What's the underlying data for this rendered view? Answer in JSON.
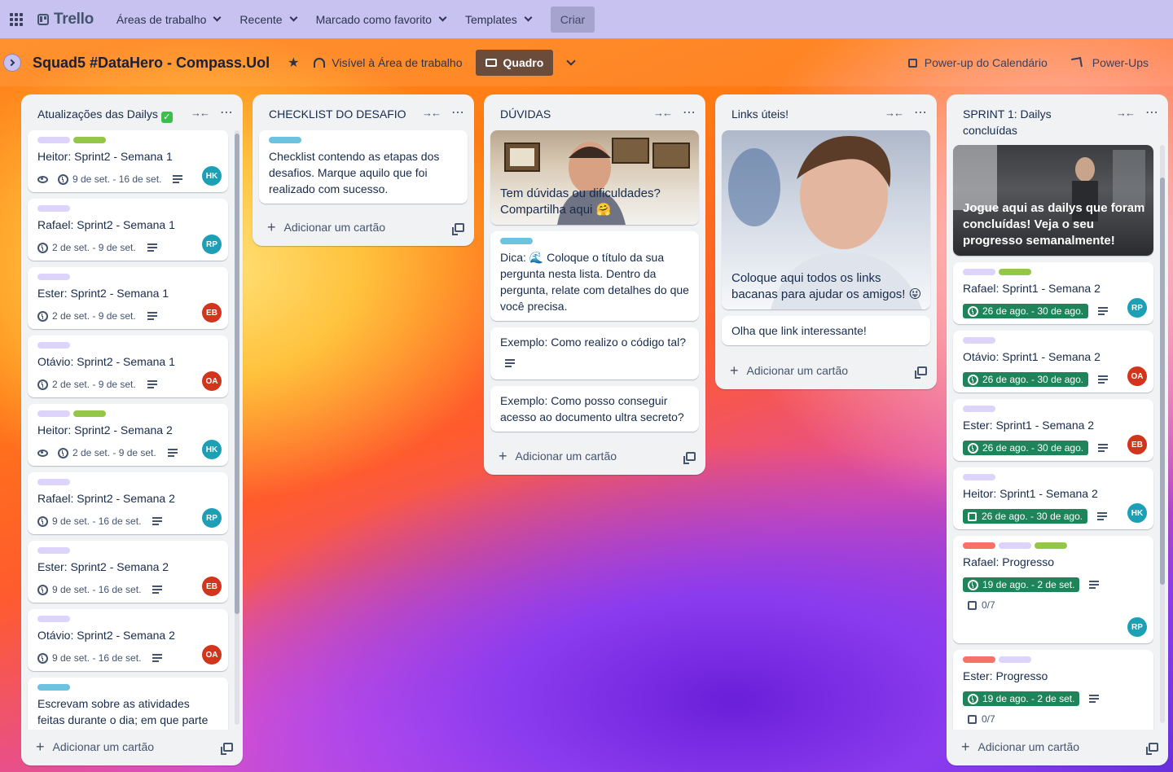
{
  "nav": {
    "logo": "Trello",
    "workspaces": "Áreas de trabalho",
    "recent": "Recente",
    "starred": "Marcado como favorito",
    "templates": "Templates",
    "create": "Criar"
  },
  "board": {
    "title": "Squad5 #DataHero - Compass.Uol",
    "visibility": "Visível à Área de trabalho",
    "view": "Quadro",
    "calendar": "Power-up do Calendário",
    "powerups": "Power-Ups"
  },
  "add_card": "Adicionar um cartão",
  "lists": [
    {
      "title": "Atualizações das Dailys",
      "cards": [
        {
          "title": "Heitor: Sprint2 - Semana 1",
          "date": "9 de set. - 16 de set.",
          "avatar": "HK"
        },
        {
          "title": "Rafael: Sprint2 - Semana 1",
          "date": "2 de set. - 9 de set.",
          "avatar": "RP"
        },
        {
          "title": "Ester: Sprint2 - Semana 1",
          "date": "2 de set. - 9 de set.",
          "avatar": "EB"
        },
        {
          "title": "Otávio: Sprint2 - Semana 1",
          "date": "2 de set. - 9 de set.",
          "avatar": "OA"
        },
        {
          "title": "Heitor: Sprint2 - Semana 2",
          "date": "2 de set. - 9 de set.",
          "avatar": "HK"
        },
        {
          "title": "Rafael: Sprint2 - Semana 2",
          "date": "9 de set. - 16 de set.",
          "avatar": "RP"
        },
        {
          "title": "Ester: Sprint2 - Semana 2",
          "date": "9 de set. - 16 de set.",
          "avatar": "EB"
        },
        {
          "title": "Otávio: Sprint2 - Semana 2",
          "date": "9 de set. - 16 de set.",
          "avatar": "OA"
        },
        {
          "title": "Escrevam sobre as atividades feitas durante o dia; em que parte estão"
        }
      ]
    },
    {
      "title": "CHECKLIST DO DESAFIO",
      "cards": [
        {
          "title": "Checklist contendo as etapas dos desafios. Marque aquilo que foi realizado com sucesso."
        }
      ]
    },
    {
      "title": "DÚVIDAS",
      "cards": [
        {
          "cover_text": "Tem dúvidas ou dificuldades? Compartilha aqui 🤗"
        },
        {
          "title": "Dica: 🌊 Coloque o título da sua pergunta nesta lista. Dentro da pergunta, relate com detalhes do que você precisa."
        },
        {
          "title": "Exemplo: Como realizo o código tal?"
        },
        {
          "title": "Exemplo: Como posso conseguir acesso ao documento ultra secreto?"
        }
      ]
    },
    {
      "title": "Links úteis!",
      "cards": [
        {
          "cover_text": "Coloque aqui todos os links bacanas para ajudar os amigos! 😜"
        },
        {
          "title": "Olha que link interessante!"
        }
      ]
    },
    {
      "title": "SPRINT 1: Dailys concluídas",
      "cards": [
        {
          "cover_text": "Jogue aqui as dailys que foram concluídas! Veja o seu progresso semanalmente!"
        },
        {
          "title": "Rafael: Sprint1 - Semana 2",
          "date": "26 de ago. - 30 de ago.",
          "avatar": "RP"
        },
        {
          "title": "Otávio: Sprint1 - Semana 2",
          "date": "26 de ago. - 30 de ago.",
          "avatar": "OA"
        },
        {
          "title": "Ester: Sprint1 - Semana 2",
          "date": "26 de ago. - 30 de ago.",
          "avatar": "EB"
        },
        {
          "title": "Heitor: Sprint1 - Semana 2",
          "date": "26 de ago. - 30 de ago.",
          "avatar": "HK"
        },
        {
          "title": "Rafael: Progresso",
          "date": "19 de ago. - 2 de set.",
          "checklist": "0/7",
          "avatar": "RP"
        },
        {
          "title": "Ester: Progresso",
          "date": "19 de ago. - 2 de set.",
          "checklist": "0/7"
        }
      ]
    }
  ],
  "colors": {
    "nav_bg": "#c7c2f0",
    "list_bg": "#f1f2f4",
    "due_complete": "#1f845a",
    "label_purple": "#dcd4fa",
    "label_green": "#94c748",
    "label_blue": "#6cc3e0",
    "label_red": "#f87168"
  }
}
